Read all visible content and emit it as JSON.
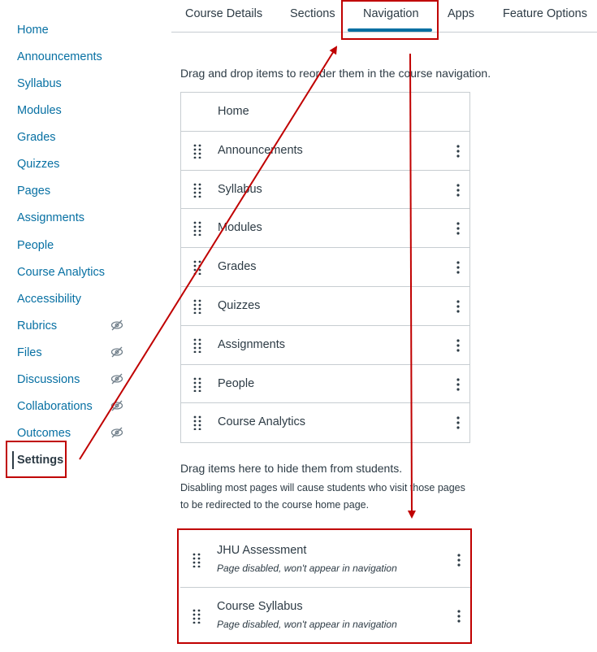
{
  "sidebar": {
    "items": [
      {
        "label": "Home",
        "hidden": false
      },
      {
        "label": "Announcements",
        "hidden": false
      },
      {
        "label": "Syllabus",
        "hidden": false
      },
      {
        "label": "Modules",
        "hidden": false
      },
      {
        "label": "Grades",
        "hidden": false
      },
      {
        "label": "Quizzes",
        "hidden": false
      },
      {
        "label": "Pages",
        "hidden": false
      },
      {
        "label": "Assignments",
        "hidden": false
      },
      {
        "label": "People",
        "hidden": false
      },
      {
        "label": "Course Analytics",
        "hidden": false
      },
      {
        "label": "Accessibility",
        "hidden": false
      },
      {
        "label": "Rubrics",
        "hidden": true
      },
      {
        "label": "Files",
        "hidden": true
      },
      {
        "label": "Discussions",
        "hidden": true
      },
      {
        "label": "Collaborations",
        "hidden": true
      },
      {
        "label": "Outcomes",
        "hidden": true
      },
      {
        "label": "Settings",
        "hidden": false
      }
    ],
    "hidden_icon": "eye-slash-icon"
  },
  "tabs": [
    {
      "label": "Course Details"
    },
    {
      "label": "Sections"
    },
    {
      "label": "Navigation"
    },
    {
      "label": "Apps"
    },
    {
      "label": "Feature Options"
    }
  ],
  "navigation": {
    "instruction": "Drag and drop items to reorder them in the course navigation.",
    "items": [
      {
        "label": "Home"
      },
      {
        "label": "Announcements"
      },
      {
        "label": "Syllabus"
      },
      {
        "label": "Modules"
      },
      {
        "label": "Grades"
      },
      {
        "label": "Quizzes"
      },
      {
        "label": "Assignments"
      },
      {
        "label": "People"
      },
      {
        "label": "Course Analytics"
      }
    ]
  },
  "hidden_section": {
    "heading": "Drag items here to hide them from students.",
    "note": "Disabling most pages will cause students who visit those pages to be redirected to the course home page.",
    "items": [
      {
        "label": "JHU Assessment",
        "status": "Page disabled, won't appear in navigation"
      },
      {
        "label": "Course Syllabus",
        "status": "Page disabled, won't appear in navigation"
      }
    ]
  },
  "colors": {
    "link": "#0770a3",
    "text": "#2d3b45",
    "annotation": "#c00000",
    "border": "#c7cdd1"
  }
}
